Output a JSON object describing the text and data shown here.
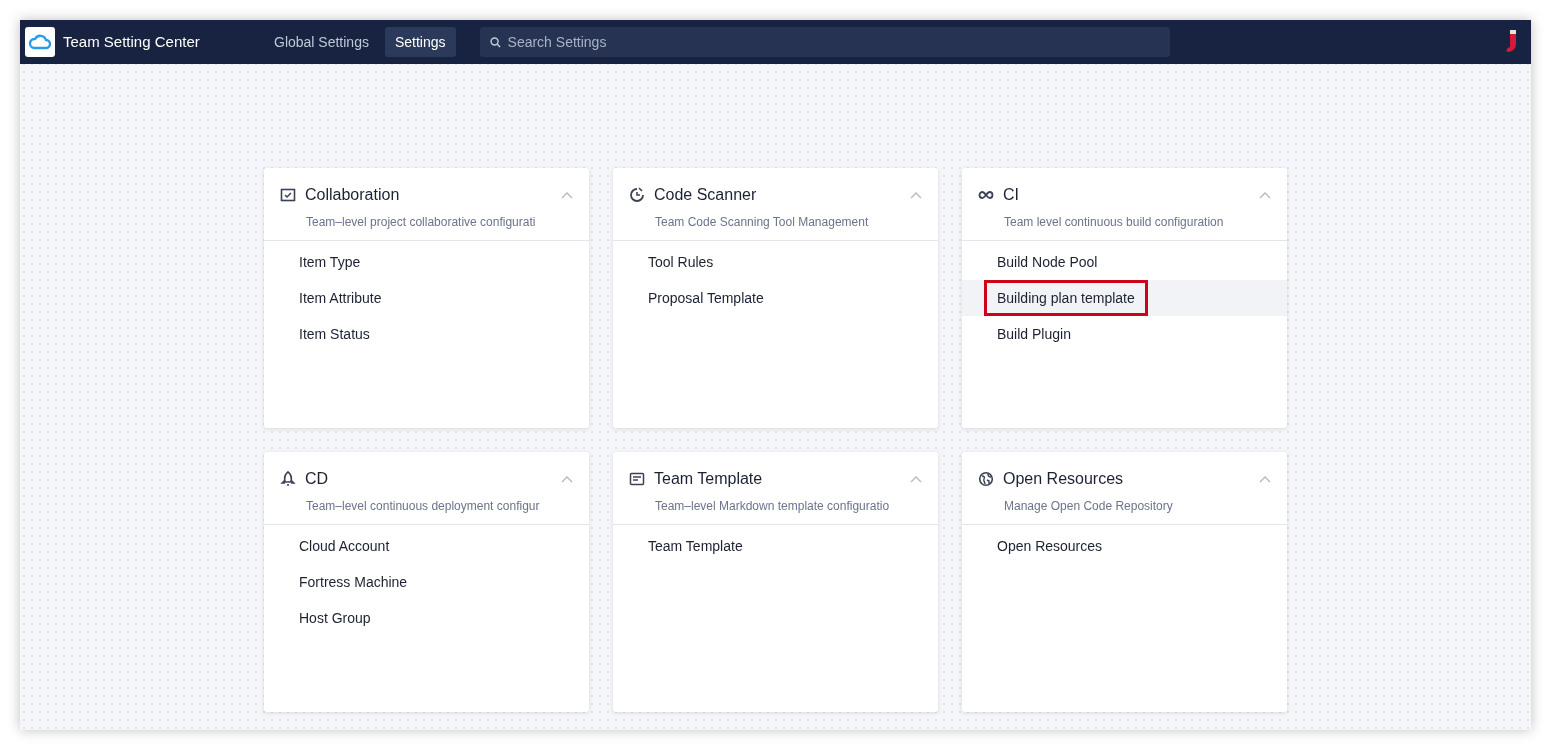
{
  "app": {
    "title": "Team Setting Center"
  },
  "nav": [
    {
      "label": "Global Settings",
      "selected": false
    },
    {
      "label": "Settings",
      "selected": true
    }
  ],
  "search": {
    "placeholder": "Search Settings"
  },
  "cards": [
    {
      "title": "Collaboration",
      "description": "Team–level project collaborative configurati",
      "expanded": true,
      "items": [
        {
          "label": "Item Type",
          "highlighted": false
        },
        {
          "label": "Item Attribute",
          "highlighted": false
        },
        {
          "label": "Item Status",
          "highlighted": false
        }
      ]
    },
    {
      "title": "Code Scanner",
      "description": "Team Code Scanning Tool Management",
      "expanded": true,
      "items": [
        {
          "label": "Tool Rules",
          "highlighted": false
        },
        {
          "label": "Proposal Template",
          "highlighted": false
        }
      ]
    },
    {
      "title": "CI",
      "description": "Team level continuous build configuration",
      "expanded": true,
      "items": [
        {
          "label": "Build Node Pool",
          "highlighted": false
        },
        {
          "label": "Building plan template",
          "highlighted": true
        },
        {
          "label": "Build Plugin",
          "highlighted": false
        }
      ]
    },
    {
      "title": "CD",
      "description": "Team–level continuous deployment configur",
      "expanded": true,
      "items": [
        {
          "label": "Cloud Account",
          "highlighted": false
        },
        {
          "label": "Fortress Machine",
          "highlighted": false
        },
        {
          "label": "Host Group",
          "highlighted": false
        }
      ]
    },
    {
      "title": "Team Template",
      "description": "Team–level Markdown template configuratio",
      "expanded": true,
      "items": [
        {
          "label": "Team Template",
          "highlighted": false
        }
      ]
    },
    {
      "title": "Open Resources",
      "description": "Manage Open Code Repository",
      "expanded": true,
      "items": [
        {
          "label": "Open Resources",
          "highlighted": false
        }
      ]
    }
  ]
}
